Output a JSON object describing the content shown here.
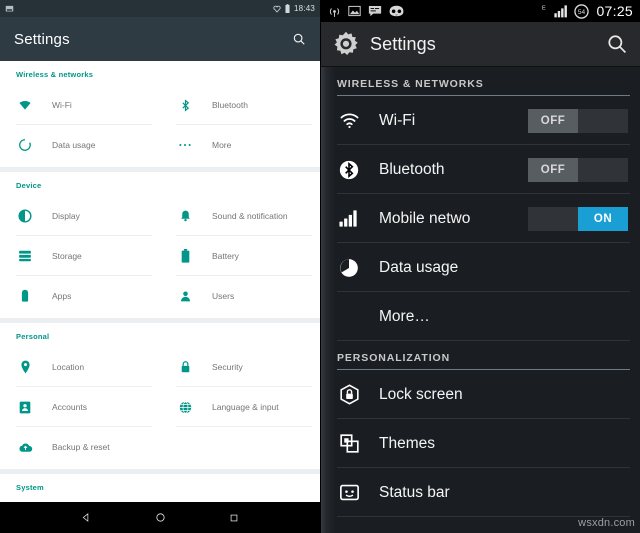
{
  "left_phone": {
    "status_bar": {
      "left_icons": [
        "screenshot-icon"
      ],
      "right_icons": [
        "heart-outline-icon",
        "battery-icon"
      ],
      "time": "18:43"
    },
    "app_bar": {
      "title": "Settings",
      "search_icon": "search-icon"
    },
    "sections": [
      {
        "header": "Wireless & networks",
        "rows": [
          [
            {
              "icon": "wifi-icon",
              "label": "Wi-Fi"
            },
            {
              "icon": "bluetooth-icon",
              "label": "Bluetooth"
            }
          ],
          [
            {
              "icon": "data-usage-icon",
              "label": "Data usage"
            },
            {
              "icon": "more-dots-icon",
              "label": "More"
            }
          ]
        ]
      },
      {
        "header": "Device",
        "rows": [
          [
            {
              "icon": "display-icon",
              "label": "Display"
            },
            {
              "icon": "bell-icon",
              "label": "Sound & notification"
            }
          ],
          [
            {
              "icon": "storage-icon",
              "label": "Storage"
            },
            {
              "icon": "battery-icon",
              "label": "Battery"
            }
          ],
          [
            {
              "icon": "apps-icon",
              "label": "Apps"
            },
            {
              "icon": "user-icon",
              "label": "Users"
            }
          ]
        ]
      },
      {
        "header": "Personal",
        "rows": [
          [
            {
              "icon": "location-pin-icon",
              "label": "Location"
            },
            {
              "icon": "lock-icon",
              "label": "Security"
            }
          ],
          [
            {
              "icon": "accounts-icon",
              "label": "Accounts"
            },
            {
              "icon": "globe-icon",
              "label": "Language & input"
            }
          ],
          [
            {
              "icon": "cloud-upload-icon",
              "label": "Backup & reset"
            },
            {
              "icon": "",
              "label": ""
            }
          ]
        ]
      },
      {
        "header": "System",
        "rows": []
      }
    ],
    "nav_bar": {
      "back": "back-triangle-icon",
      "home": "home-circle-icon",
      "recents": "recents-square-icon"
    }
  },
  "right_phone": {
    "status_bar": {
      "left_icons": [
        "cast-wireless-icon",
        "image-icon",
        "sms-message-icon",
        "cyanogenmod-icon"
      ],
      "network_type": "E",
      "signal_icon": "signal-bars-icon",
      "battery_percent": "54",
      "time": "07:25"
    },
    "action_bar": {
      "gear_icon": "gear-icon",
      "title": "Settings",
      "search_icon": "search-icon"
    },
    "sections": [
      {
        "header": "WIRELESS & NETWORKS",
        "items": [
          {
            "icon": "wifi-icon",
            "label": "Wi-Fi",
            "toggle": "OFF",
            "toggle_state": "off"
          },
          {
            "icon": "bluetooth-icon",
            "label": "Bluetooth",
            "toggle": "OFF",
            "toggle_state": "off"
          },
          {
            "icon": "signal-bars-icon",
            "label": "Mobile netwo",
            "toggle": "ON",
            "toggle_state": "on"
          },
          {
            "icon": "data-usage-icon",
            "label": "Data usage",
            "toggle": "",
            "toggle_state": ""
          },
          {
            "icon": "",
            "label": "More…",
            "toggle": "",
            "toggle_state": ""
          }
        ]
      },
      {
        "header": "PERSONALIZATION",
        "items": [
          {
            "icon": "lock-screen-icon",
            "label": "Lock screen",
            "toggle": "",
            "toggle_state": ""
          },
          {
            "icon": "themes-icon",
            "label": "Themes",
            "toggle": "",
            "toggle_state": ""
          },
          {
            "icon": "status-bar-icon",
            "label": "Status bar",
            "toggle": "",
            "toggle_state": ""
          }
        ]
      }
    ]
  },
  "watermark": "wsxdn.com",
  "colors": {
    "left_accent": "#009688",
    "left_appbar": "#2e3b43",
    "right_toggle_on": "#1a9fd4",
    "right_actionbar": "#27292c"
  }
}
